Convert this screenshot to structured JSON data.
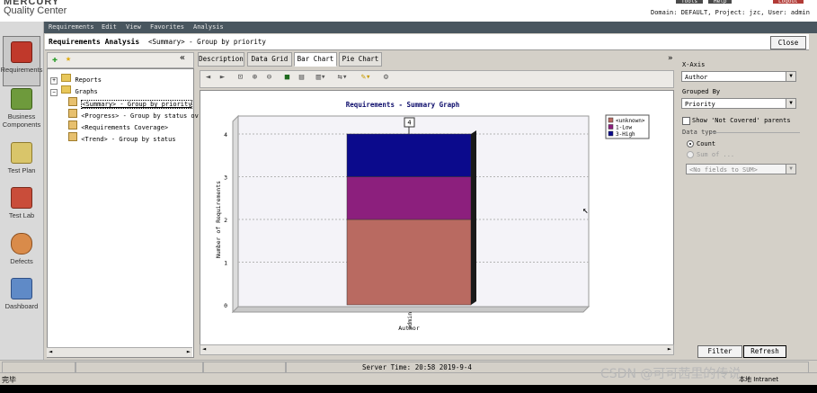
{
  "app": {
    "brand_top": "MERCURY",
    "brand": "Quality Center",
    "context": "Domain: DEFAULT, Project: jzc, User: admin",
    "top_links": [
      "Tools",
      "Help",
      "Logout"
    ]
  },
  "menu": [
    "Requirements",
    "Edit",
    "View",
    "Favorites",
    "Analysis"
  ],
  "nav": [
    {
      "label": "Requirements",
      "icon": "requirements-icon"
    },
    {
      "label": "Business Components",
      "icon": "business-components-icon"
    },
    {
      "label": "Test Plan",
      "icon": "test-plan-icon"
    },
    {
      "label": "Test Lab",
      "icon": "test-lab-icon"
    },
    {
      "label": "Defects",
      "icon": "defects-icon"
    },
    {
      "label": "Dashboard",
      "icon": "dashboard-icon"
    }
  ],
  "title": {
    "main": "Requirements Analysis",
    "sub": "<Summary> - Group by priority",
    "close_label": "Close"
  },
  "tree": {
    "reports": "Reports",
    "graphs": "Graphs",
    "items": [
      "<Summary> - Group by priority",
      "<Progress> - Group by status ov",
      "<Requirements Coverage>",
      "<Trend> - Group by status"
    ]
  },
  "tabs": [
    "Description",
    "Data Grid",
    "Bar Chart",
    "Pie Chart"
  ],
  "active_tab": "Bar Chart",
  "chart_data": {
    "type": "bar",
    "stacked": true,
    "title": "Requirements - Summary Graph",
    "xlabel": "Author",
    "ylabel": "Number of Requirements",
    "categories": [
      "admin"
    ],
    "series": [
      {
        "name": "<unknown>",
        "values": [
          2
        ],
        "color": "#b96a61"
      },
      {
        "name": "1-Low",
        "values": [
          1
        ],
        "color": "#8c1f7d"
      },
      {
        "name": "3-High",
        "values": [
          1
        ],
        "color": "#0b0a8c"
      }
    ],
    "ylim": [
      0,
      4
    ],
    "yticks": [
      "0",
      "1",
      "2",
      "3",
      "4"
    ],
    "total_label": "4",
    "grid": true,
    "legend": "top-right"
  },
  "right_panel": {
    "xaxis_label": "X-Axis",
    "xaxis_value": "Author",
    "groupby_label": "Grouped By",
    "groupby_value": "Priority",
    "show_not_covered": "Show 'Not Covered' parents",
    "datatype_label": "Data type",
    "count_label": "Count",
    "sumof_label": "Sum of ...",
    "sum_field_placeholder": "<No fields to SUM>",
    "filter_label": "Filter",
    "refresh_label": "Refresh"
  },
  "status": {
    "server_time": "Server Time: 20:58 2019-9-4",
    "done": "完毕",
    "zone": "本地 Intranet"
  },
  "watermark": "CSDN @可可茜里的传说"
}
